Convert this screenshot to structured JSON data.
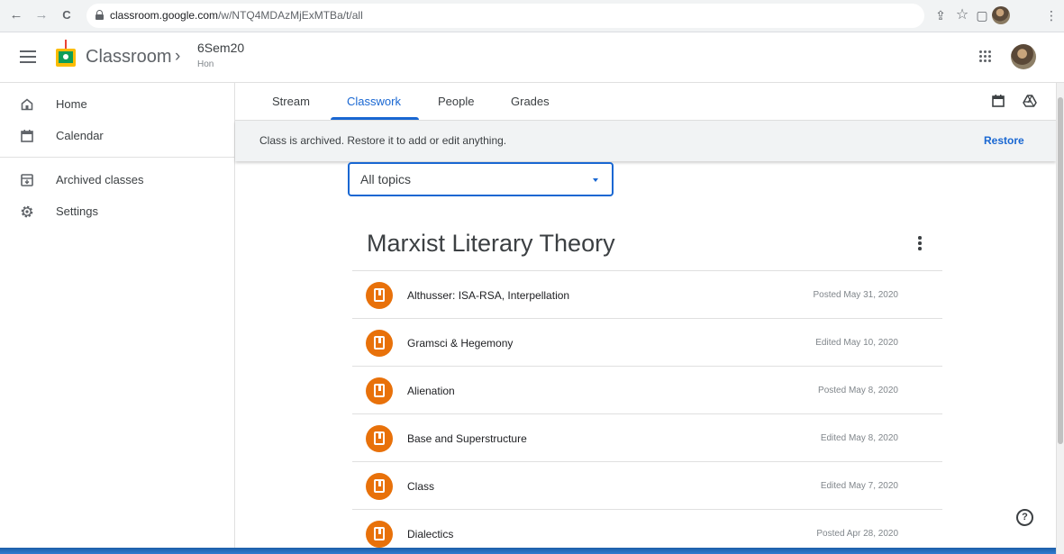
{
  "browser": {
    "back": "←",
    "forward": "→",
    "reload": "C",
    "url_host": "classroom.google.com",
    "url_path": "/w/NTQ4MDAzMjExMTBa/t/all",
    "share": "⇪",
    "bookmark": "☆",
    "sidepanel": "▢",
    "more": "⋮"
  },
  "header": {
    "app_name": "Classroom",
    "separator": "›",
    "class_name": "6Sem20",
    "class_section": "Hon"
  },
  "sidebar": {
    "items": [
      {
        "label": "Home",
        "icon": "home-icon"
      },
      {
        "label": "Calendar",
        "icon": "calendar-icon"
      },
      {
        "label": "Archived classes",
        "icon": "archive-icon"
      },
      {
        "label": "Settings",
        "icon": "gear-icon"
      }
    ]
  },
  "tabs": [
    {
      "label": "Stream"
    },
    {
      "label": "Classwork"
    },
    {
      "label": "People"
    },
    {
      "label": "Grades"
    }
  ],
  "banner": {
    "text": "Class is archived. Restore it to add or edit anything.",
    "action": "Restore"
  },
  "topic_filter": {
    "value": "All topics"
  },
  "topic": {
    "title": "Marxist Literary Theory",
    "materials": [
      {
        "title": "Althusser: ISA-RSA, Interpellation",
        "date": "Posted May 31, 2020"
      },
      {
        "title": "Gramsci & Hegemony",
        "date": "Edited May 10, 2020"
      },
      {
        "title": "Alienation",
        "date": "Posted May 8, 2020"
      },
      {
        "title": "Base and Superstructure",
        "date": "Edited May 8, 2020"
      },
      {
        "title": "Class",
        "date": "Edited May 7, 2020"
      },
      {
        "title": "Dialectics",
        "date": "Posted Apr 28, 2020"
      }
    ]
  },
  "help": "?",
  "colors": {
    "accent": "#1967d2",
    "material_icon": "#e8710a",
    "banner_bg": "#f1f3f4"
  }
}
